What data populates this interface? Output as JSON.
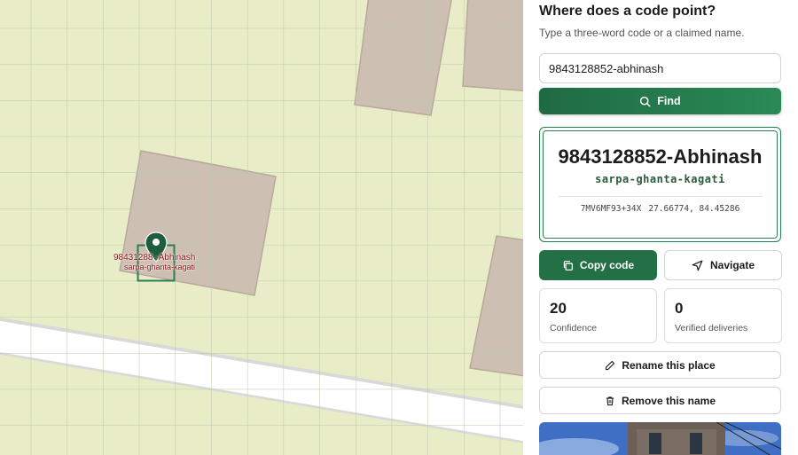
{
  "panel": {
    "title": "Where does a code point?",
    "subtitle": "Type a three-word code or a claimed name.",
    "search": {
      "value": "9843128852-abhinash",
      "placeholder": ""
    },
    "find_label": "Find"
  },
  "result": {
    "name": "9843128852-Abhinash",
    "words": "sarpa-ghanta-kagati",
    "plus_code": "7MV6MF93+34X",
    "coordinates": "27.66774, 84.45286"
  },
  "actions": {
    "copy_label": "Copy code",
    "navigate_label": "Navigate"
  },
  "stats": [
    {
      "value": "20",
      "label": "Confidence"
    },
    {
      "value": "0",
      "label": "Verified deliveries"
    }
  ],
  "buttons": {
    "rename_label": "Rename this place",
    "remove_label": "Remove this name"
  },
  "map": {
    "marker_name": "9843128852-Abhinash",
    "marker_words": "sarpa-ghanta-kagati",
    "marker_name_visible": "98431288 -Abhinash"
  },
  "colors": {
    "accent": "#236f46",
    "map_bg": "#e8edc8",
    "building": "#cdbfb2",
    "label_red": "#8b1212"
  },
  "icons": {
    "find": "search-icon",
    "copy": "copy-icon",
    "navigate": "navigation-arrow-icon",
    "rename": "pencil-icon",
    "remove": "trash-icon",
    "marker": "map-pin-icon"
  }
}
